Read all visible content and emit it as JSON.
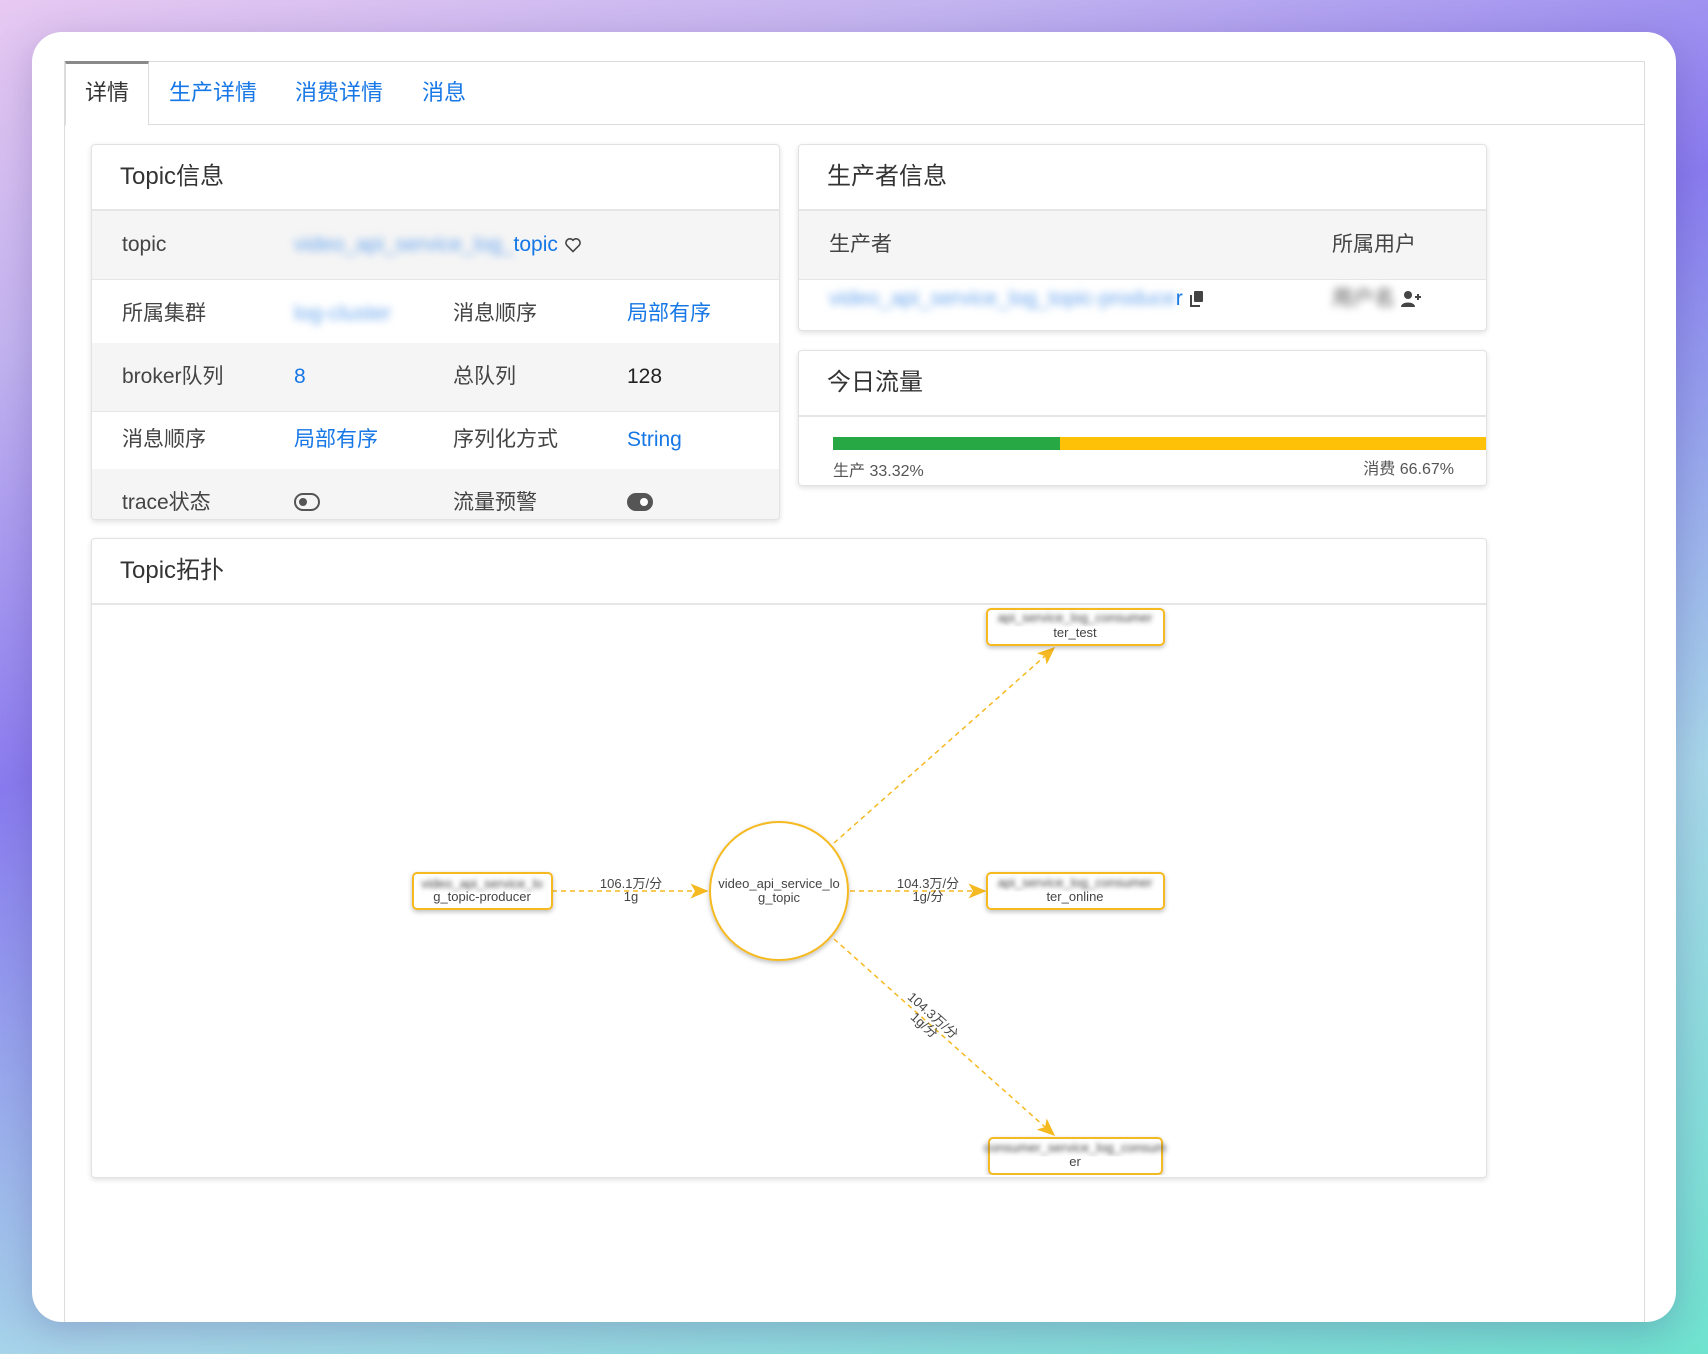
{
  "tabs": [
    "详情",
    "生产详情",
    "消费详情",
    "消息"
  ],
  "topic_info": {
    "title": "Topic信息",
    "rows": [
      {
        "label1": "topic",
        "value1_blur": "video_api_service_log_",
        "value1": "topic"
      },
      {
        "label1": "所属集群",
        "value1_blur": "log-cluster",
        "label2": "消息顺序",
        "value2": "局部有序"
      },
      {
        "label1": "broker队列",
        "value1": "8",
        "label2": "总队列",
        "value2": "128"
      },
      {
        "label1": "消息顺序",
        "value1": "局部有序",
        "label2": "序列化方式",
        "value2": "String"
      },
      {
        "label1": "trace状态",
        "label2": "流量预警"
      }
    ],
    "trace_enabled": false,
    "traffic_alert_enabled": true
  },
  "producer_info": {
    "title": "生产者信息",
    "col_producer": "生产者",
    "col_user": "所属用户",
    "producer_blur": "video_api_service_log_topic-produce",
    "producer_tail": "r",
    "user_blur": "用户名"
  },
  "traffic": {
    "title": "今日流量",
    "produce_label": "生产 33.32%",
    "consume_label": "消费 66.67%",
    "produce_ratio": 0.3332,
    "consume_ratio": 0.6667,
    "colors": {
      "produce": "#28a745",
      "consume": "#ffc107"
    }
  },
  "topology": {
    "title": "Topic拓扑",
    "center": {
      "line1": "video_api_service_lo",
      "line2": "g_topic"
    },
    "producer": {
      "line1_blur": "video_api_service_lo",
      "line2": "g_topic-producer"
    },
    "consumers": [
      {
        "line1_blur": "api_service_log_consumer",
        "line2": "ter_test"
      },
      {
        "line1_blur": "api_service_log_consumer",
        "line2": "ter_online"
      },
      {
        "line1_blur": "consumer_service_log_consum",
        "line2": "er"
      }
    ],
    "edges": [
      {
        "line1": "106.1万/分",
        "line2": "1g"
      },
      {
        "line1": "104.3万/分",
        "line2": "1g/分"
      },
      {
        "line1": "104.3万/分",
        "line2": "1g/分"
      }
    ],
    "accent": "#f5b921"
  }
}
